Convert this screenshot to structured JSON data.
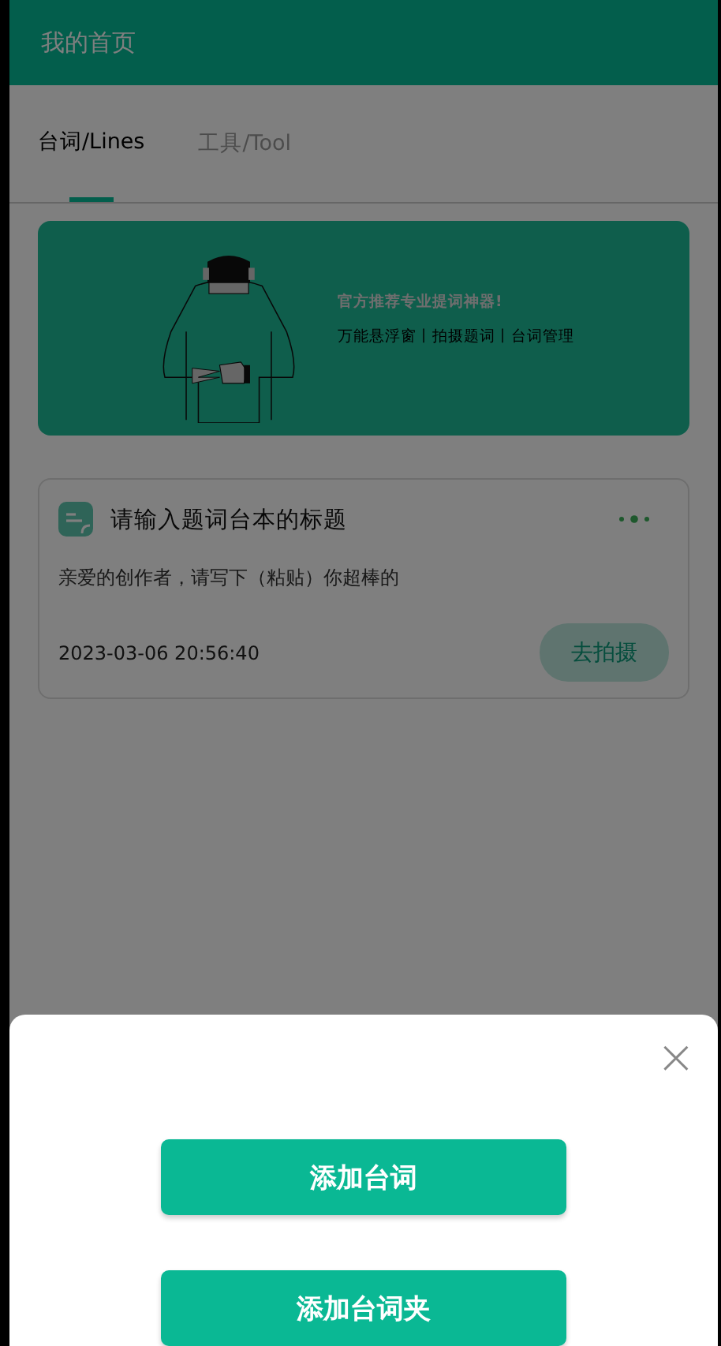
{
  "header": {
    "title": "我的首页"
  },
  "tabs": [
    {
      "label": "台词/Lines",
      "selected": true
    },
    {
      "label": "工具/Tool",
      "selected": false
    }
  ],
  "banner": {
    "title": "官方推荐专业提词神器!",
    "subtitle": "万能悬浮窗丨拍摄题词丨台词管理"
  },
  "scripts": [
    {
      "title": "请输入题词台本的标题",
      "body": "亲爱的创作者，请写下（粘贴）你超棒的",
      "date": "2023-03-06 20:56:40",
      "action": "去拍摄"
    }
  ],
  "sheet": {
    "close": "×",
    "buttons": [
      "添加台词",
      "添加台词夹"
    ]
  }
}
